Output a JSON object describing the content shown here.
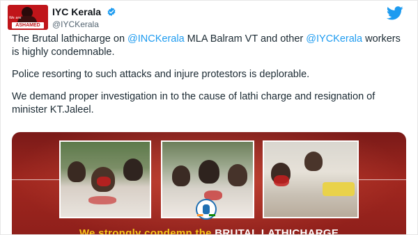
{
  "author": {
    "display_name": "IYC Kerala",
    "handle": "@IYCKerala",
    "avatar_badge": "ASHAMED",
    "avatar_caption": "We are"
  },
  "icons": {
    "verified": "verified-badge-icon",
    "platform": "twitter-bird-icon"
  },
  "tweet": {
    "p1_part1": "The Brutal lathicharge on ",
    "p1_mention1": "@INCKerala",
    "p1_part2": " MLA Balram VT and other ",
    "p1_mention2": "@IYCKerala",
    "p1_part3": " workers is highly condemnable.",
    "p2": "Police resorting to such attacks and injure protestors is deplorable.",
    "p3": "We demand proper investigation in to the cause of lathi charge and resignation of minister KT.Jaleel."
  },
  "media": {
    "caption_part1": "We strongly condemn the ",
    "caption_part2": "BRUTAL LATHICHARGE"
  },
  "colors": {
    "mention": "#1d9bf0",
    "media_bg": "#a0271f",
    "caption_yellow": "#f5c518",
    "verified": "#1d9bf0"
  }
}
